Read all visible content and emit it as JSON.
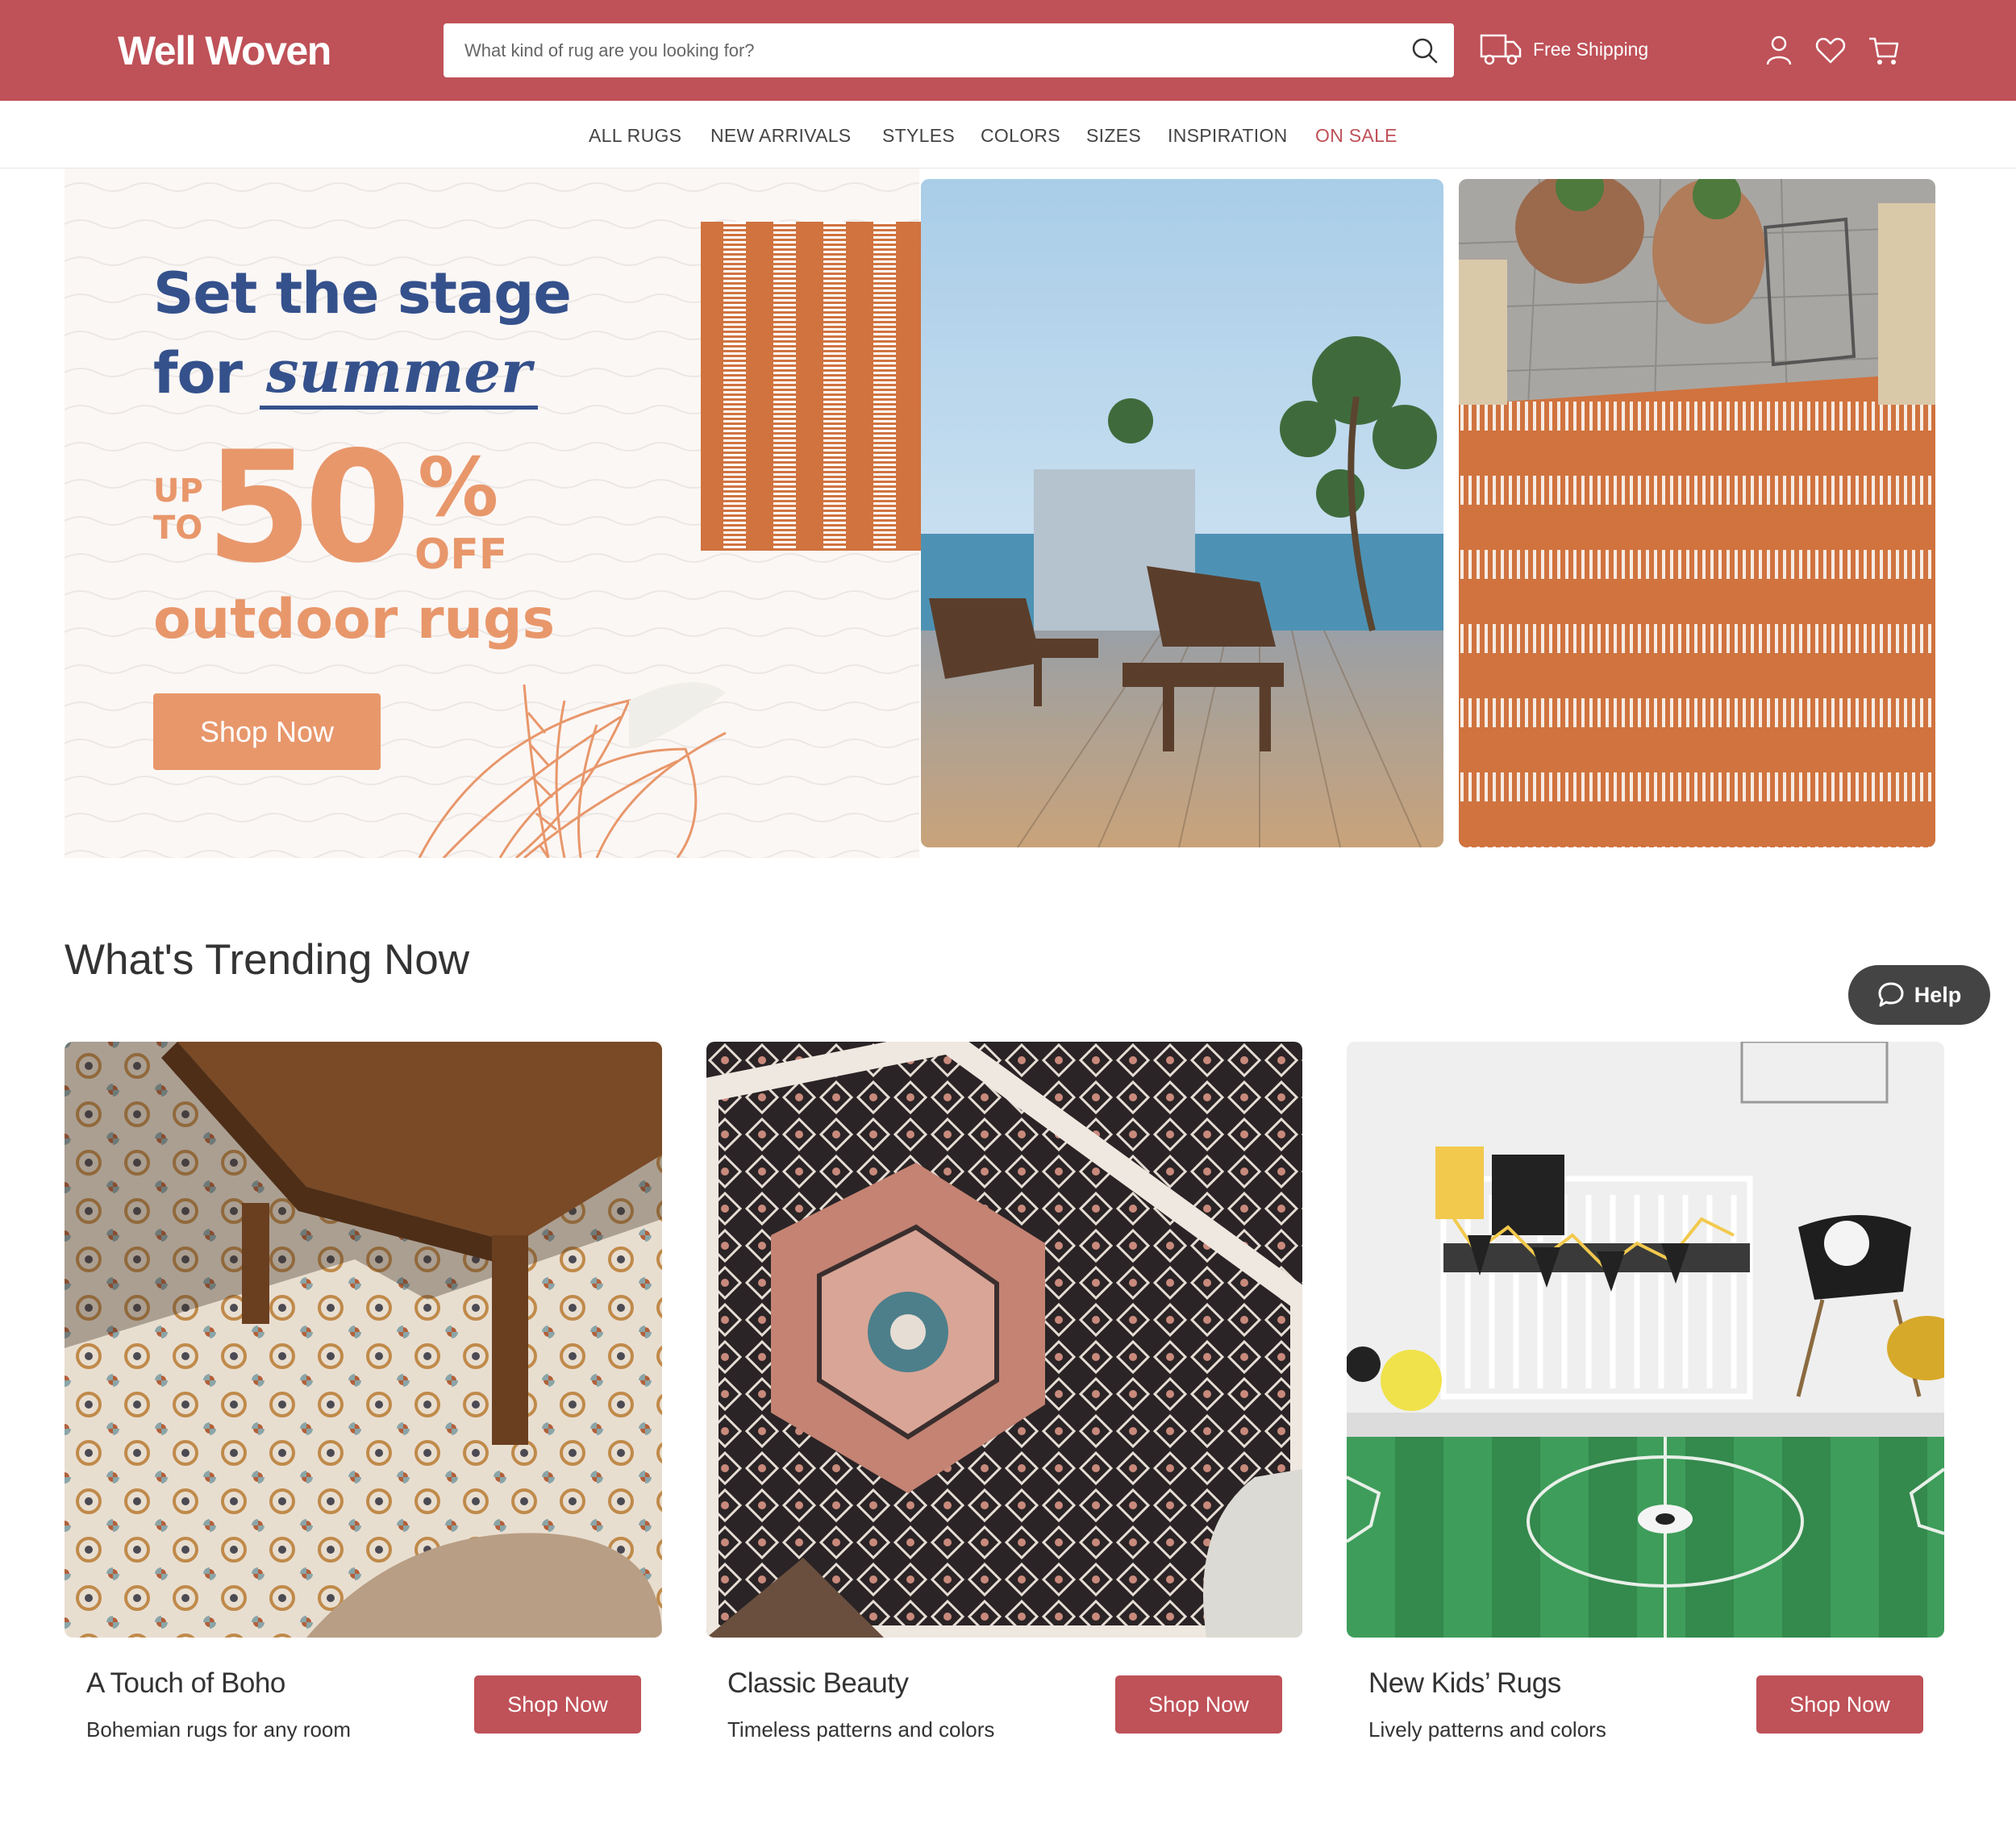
{
  "header": {
    "logo": "Well Woven",
    "search_placeholder": "What kind of rug are you looking for?",
    "shipping_label": "Free Shipping"
  },
  "nav": {
    "items": [
      "ALL RUGS",
      "NEW ARRIVALS",
      "STYLES",
      "COLORS",
      "SIZES",
      "INSPIRATION",
      "ON SALE"
    ]
  },
  "hero": {
    "title_line1": "Set the stage",
    "title_for": "for",
    "title_script": "summer",
    "up": "UP",
    "to": "TO",
    "discount_number": "50",
    "percent": "%",
    "off": "OFF",
    "subtitle": "outdoor rugs",
    "button": "Shop Now"
  },
  "trending": {
    "title": "What's Trending Now",
    "cards": [
      {
        "title": "A Touch of Boho",
        "subtitle": "Bohemian rugs for any room",
        "button": "Shop Now"
      },
      {
        "title": "Classic Beauty",
        "subtitle": "Timeless patterns and colors",
        "button": "Shop Now"
      },
      {
        "title": "New Kids’ Rugs",
        "subtitle": "Lively patterns and colors",
        "button": "Shop Now"
      }
    ]
  },
  "help": {
    "label": "Help"
  },
  "colors": {
    "brand": "#bf5158",
    "hero_blue": "#35518c",
    "hero_orange": "#e8976b",
    "rug_orange": "#d0733f"
  }
}
